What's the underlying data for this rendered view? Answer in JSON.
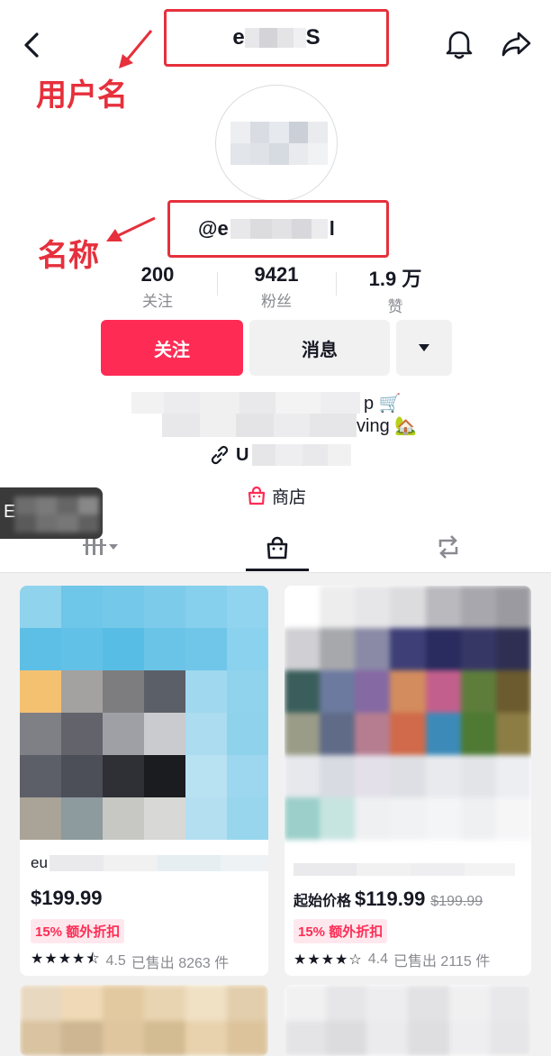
{
  "header": {
    "username_start": "e",
    "username_end": "S"
  },
  "annotations": {
    "username_label": "用户名",
    "name_label": "名称"
  },
  "profile": {
    "handle_start": "@e",
    "handle_end": "l"
  },
  "stats": [
    {
      "value": "200",
      "label": "关注"
    },
    {
      "value": "9421",
      "label": "粉丝"
    },
    {
      "value": "1.9 万",
      "label": "赞"
    }
  ],
  "actions": {
    "follow": "关注",
    "message": "消息"
  },
  "bio": {
    "line1_end": "p 🛒",
    "line2_end": "ving 🏡"
  },
  "link": {
    "text_start": "U"
  },
  "shop": {
    "label": "商店"
  },
  "floating": {
    "letter": "E"
  },
  "products": [
    {
      "title_start": "eu",
      "price_prefix": "",
      "price": "$199.99",
      "original_price": "",
      "badge": "15% 额外折扣",
      "stars": "★★★★⯪",
      "rating": "4.5",
      "sold": "已售出 8263 件"
    },
    {
      "title_start": "",
      "price_prefix": "起始价格",
      "price": "$119.99",
      "original_price": "$199.99",
      "badge": "15% 额外折扣",
      "stars": "★★★★☆",
      "rating": "4.4",
      "sold": "已售出 2115 件"
    }
  ],
  "colors": {
    "accent": "#fe2c55",
    "annotation": "#e6303c"
  }
}
